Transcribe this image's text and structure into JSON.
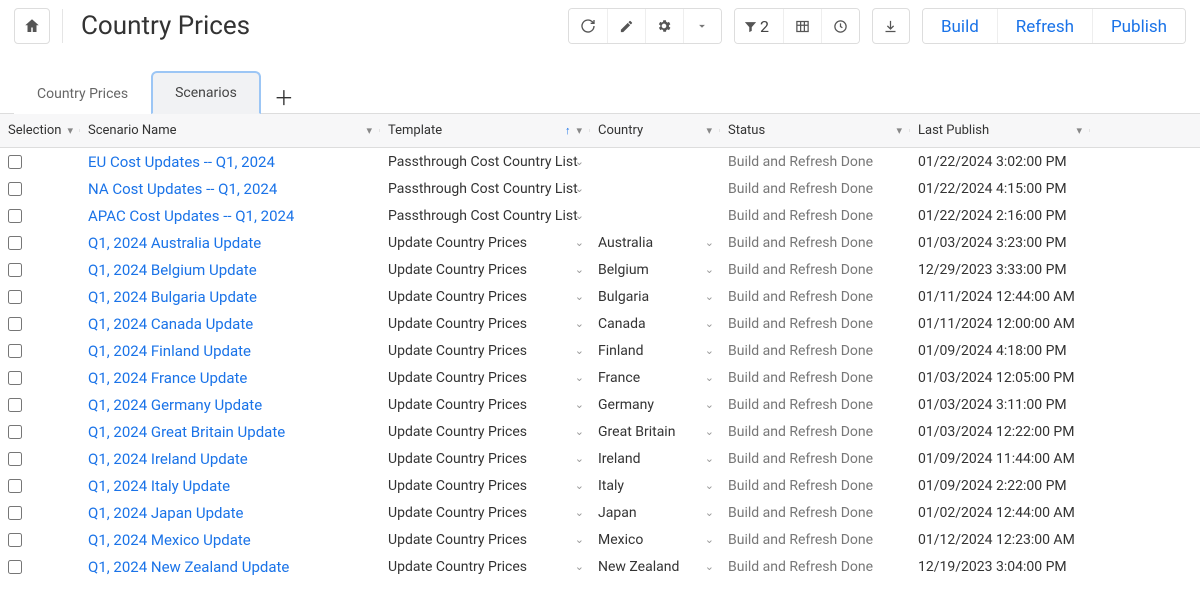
{
  "header": {
    "title": "Country Prices",
    "filter_count": "2",
    "actions": {
      "build": "Build",
      "refresh": "Refresh",
      "publish": "Publish"
    }
  },
  "tabs": {
    "items": [
      {
        "label": "Country Prices",
        "active": false
      },
      {
        "label": "Scenarios",
        "active": true
      }
    ]
  },
  "columns": {
    "selection": "Selection",
    "scenario": "Scenario Name",
    "template": "Template",
    "country": "Country",
    "status": "Status",
    "last_publish": "Last Publish"
  },
  "rows": [
    {
      "scenario": "EU Cost Updates -- Q1, 2024",
      "template": "Passthrough Cost Country List",
      "country": "",
      "status": "Build and Refresh Done",
      "last_publish": "01/22/2024 3:02:00 PM"
    },
    {
      "scenario": "NA Cost Updates -- Q1, 2024",
      "template": "Passthrough Cost Country List",
      "country": "",
      "status": "Build and Refresh Done",
      "last_publish": "01/22/2024 4:15:00 PM"
    },
    {
      "scenario": "APAC Cost Updates -- Q1, 2024",
      "template": "Passthrough Cost Country List",
      "country": "",
      "status": "Build and Refresh Done",
      "last_publish": "01/22/2024 2:16:00 PM"
    },
    {
      "scenario": "Q1, 2024 Australia Update",
      "template": "Update Country Prices",
      "country": "Australia",
      "status": "Build and Refresh Done",
      "last_publish": "01/03/2024 3:23:00 PM"
    },
    {
      "scenario": "Q1, 2024 Belgium Update",
      "template": "Update Country Prices",
      "country": "Belgium",
      "status": "Build and Refresh Done",
      "last_publish": "12/29/2023 3:33:00 PM"
    },
    {
      "scenario": "Q1, 2024 Bulgaria Update",
      "template": "Update Country Prices",
      "country": "Bulgaria",
      "status": "Build and Refresh Done",
      "last_publish": "01/11/2024 12:44:00 AM"
    },
    {
      "scenario": "Q1, 2024 Canada Update",
      "template": "Update Country Prices",
      "country": "Canada",
      "status": "Build and Refresh Done",
      "last_publish": "01/11/2024 12:00:00 AM"
    },
    {
      "scenario": "Q1, 2024 Finland Update",
      "template": "Update Country Prices",
      "country": "Finland",
      "status": "Build and Refresh Done",
      "last_publish": "01/09/2024 4:18:00 PM"
    },
    {
      "scenario": "Q1, 2024 France Update",
      "template": "Update Country Prices",
      "country": "France",
      "status": "Build and Refresh Done",
      "last_publish": "01/03/2024 12:05:00 PM"
    },
    {
      "scenario": "Q1, 2024 Germany Update",
      "template": "Update Country Prices",
      "country": "Germany",
      "status": "Build and Refresh Done",
      "last_publish": "01/03/2024 3:11:00 PM"
    },
    {
      "scenario": "Q1, 2024 Great Britain Update",
      "template": "Update Country Prices",
      "country": "Great Britain",
      "status": "Build and Refresh Done",
      "last_publish": "01/03/2024 12:22:00 PM"
    },
    {
      "scenario": "Q1, 2024 Ireland Update",
      "template": "Update Country Prices",
      "country": "Ireland",
      "status": "Build and Refresh Done",
      "last_publish": "01/09/2024 11:44:00 AM"
    },
    {
      "scenario": "Q1, 2024 Italy Update",
      "template": "Update Country Prices",
      "country": "Italy",
      "status": "Build and Refresh Done",
      "last_publish": "01/09/2024 2:22:00 PM"
    },
    {
      "scenario": "Q1, 2024 Japan Update",
      "template": "Update Country Prices",
      "country": "Japan",
      "status": "Build and Refresh Done",
      "last_publish": "01/02/2024 12:44:00 AM"
    },
    {
      "scenario": "Q1, 2024 Mexico Update",
      "template": "Update Country Prices",
      "country": "Mexico",
      "status": "Build and Refresh Done",
      "last_publish": "01/12/2024 12:23:00 AM"
    },
    {
      "scenario": "Q1, 2024 New Zealand Update",
      "template": "Update Country Prices",
      "country": "New Zealand",
      "status": "Build and Refresh Done",
      "last_publish": "12/19/2023 3:04:00 PM"
    }
  ]
}
